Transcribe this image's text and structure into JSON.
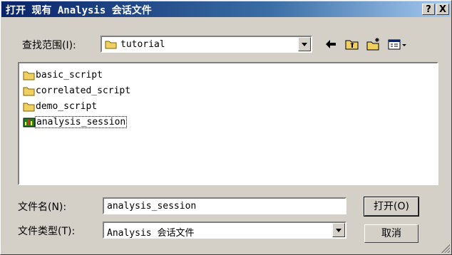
{
  "window": {
    "title": "打开 现有 Analysis 会话文件",
    "help_label": "?",
    "close_label": "X"
  },
  "lookin": {
    "label": "查找范围(I):",
    "value": "tutorial"
  },
  "toolbar": {
    "icons": [
      "back-icon",
      "up-folder-icon",
      "new-folder-icon",
      "view-menu-icon"
    ]
  },
  "files": [
    {
      "name": "basic_script",
      "type": "folder"
    },
    {
      "name": "correlated_script",
      "type": "folder"
    },
    {
      "name": "demo_script",
      "type": "folder"
    },
    {
      "name": "analysis_session",
      "type": "session",
      "selected": true
    }
  ],
  "filename": {
    "label": "文件名(N):",
    "value": "analysis_session"
  },
  "filetype": {
    "label": "文件类型(T):",
    "value": "Analysis 会话文件"
  },
  "buttons": {
    "open": "打开(O)",
    "cancel": "取消"
  },
  "colors": {
    "title_start": "#0a246a",
    "title_end": "#a6caf0",
    "face": "#d4d0c8",
    "folder": "#f0d060"
  }
}
